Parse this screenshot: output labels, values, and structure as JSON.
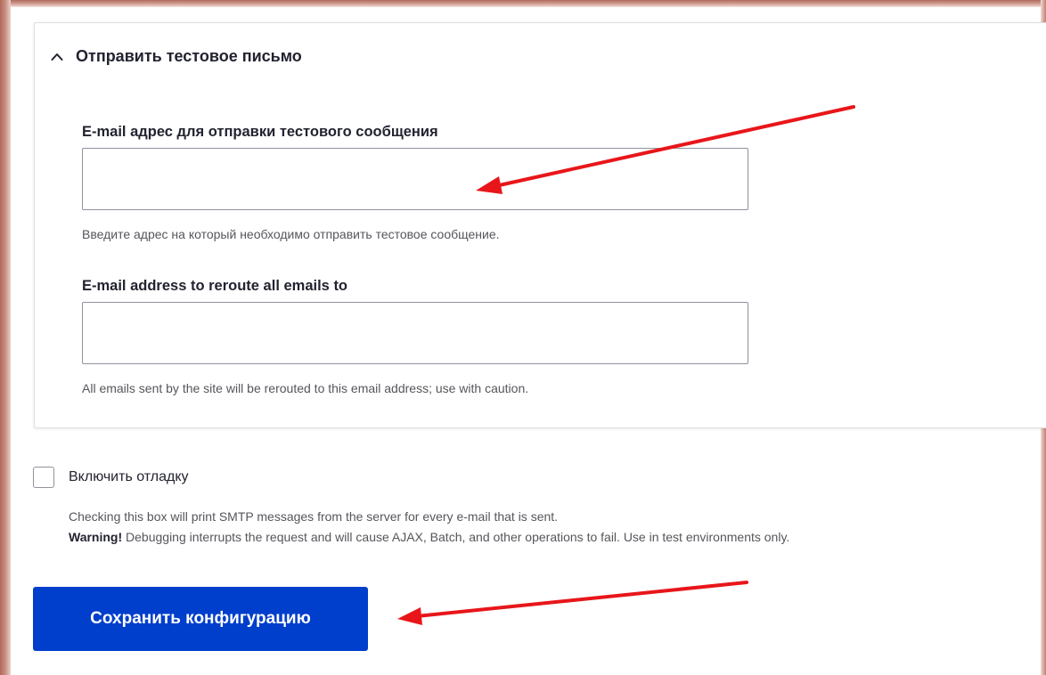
{
  "section": {
    "title": "Отправить тестовое письмо",
    "icon": "chevron-up-icon"
  },
  "test_email": {
    "label": "E-mail адрес для отправки тестового сообщения",
    "value": "",
    "description": "Введите адрес на который необходимо отправить тестовое сообщение."
  },
  "reroute_email": {
    "label": "E-mail address to reroute all emails to",
    "value": "",
    "description": "All emails sent by the site will be rerouted to this email address; use with caution."
  },
  "debug": {
    "label": "Включить отладку",
    "checked": false,
    "description": "Checking this box will print SMTP messages from the server for every e-mail that is sent.",
    "warning_strong": "Warning!",
    "warning_text": " Debugging interrupts the request and will cause AJAX, Batch, and other operations to fail. Use in test environments only."
  },
  "save_button": {
    "label": "Сохранить конфигурацию"
  },
  "colors": {
    "primary": "#003ecc",
    "annotation_arrow": "#e8161a",
    "border": "#8e929c"
  }
}
